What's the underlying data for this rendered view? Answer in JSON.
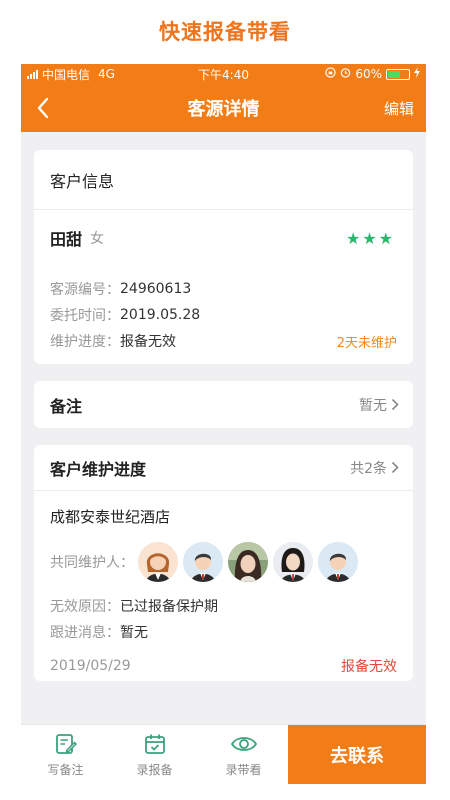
{
  "promo_title": "快速报备带看",
  "status_bar": {
    "carrier": "中国电信",
    "network": "4G",
    "time": "下午4:40",
    "battery_percent": "60%",
    "battery_level": 0.6
  },
  "nav": {
    "title": "客源详情",
    "edit_label": "编辑"
  },
  "customer_info": {
    "section_title": "客户信息",
    "name": "田甜",
    "gender": "女",
    "stars": "★★★",
    "star_color": "#2cb66e",
    "id_label": "客源编号：",
    "id_value": "24960613",
    "entrust_label": "委托时间：",
    "entrust_value": "2019.05.28",
    "progress_label": "维护进度：",
    "progress_value": "报备无效",
    "maintenance_alert": "2天未维护"
  },
  "remarks": {
    "label": "备注",
    "value": "暂无"
  },
  "maintenance": {
    "section_title": "客户维护进度",
    "count_label": "共2条",
    "hotel": "成都安泰世纪酒店",
    "co_maintainers_label": "共同维护人：",
    "invalid_reason_label": "无效原因：",
    "invalid_reason_value": "已过报备保护期",
    "follow_label": "跟进消息：",
    "follow_value": "暂无",
    "date": "2019/05/29",
    "status": "报备无效"
  },
  "tabbar": {
    "write_note": "写备注",
    "record_report": "录报备",
    "record_visit": "录带看",
    "contact": "去联系"
  },
  "colors": {
    "brand_orange": "#f27d16",
    "status_red": "#e5483a",
    "alert_orange": "#f0881c",
    "icon_green": "#3aa37a"
  }
}
